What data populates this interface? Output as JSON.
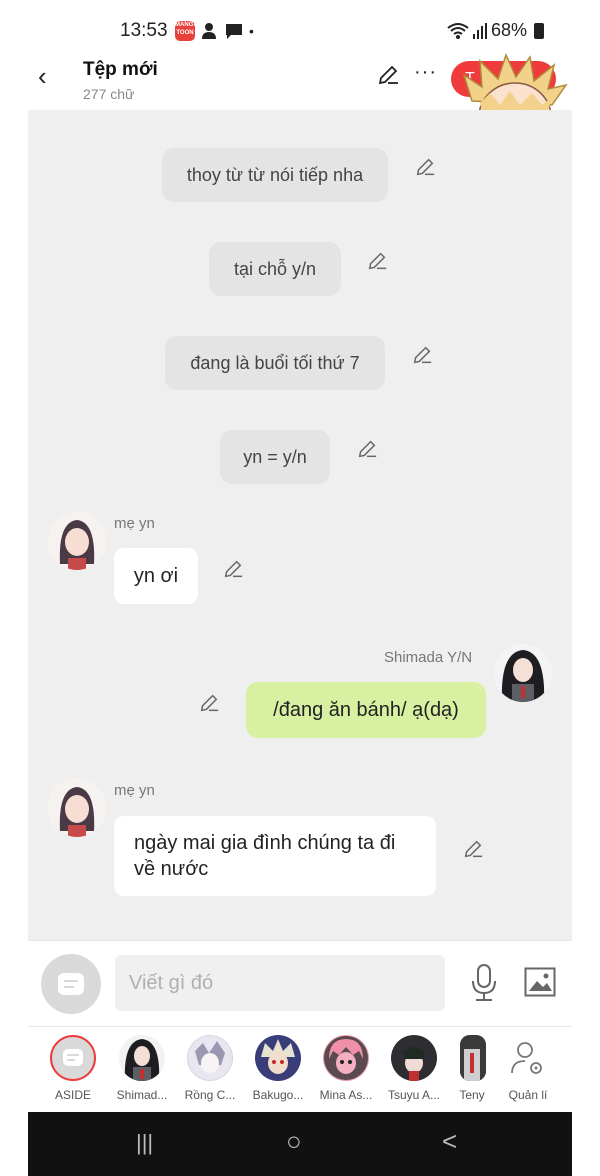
{
  "status_bar": {
    "time": "13:53",
    "battery": "68%",
    "app_badge": "MANGA TOON"
  },
  "header": {
    "title": "Tệp mới",
    "subtitle": "277 chữ",
    "more": "···",
    "red_button_label": "T"
  },
  "messages": {
    "narration": [
      "thoy từ từ nói tiếp nha",
      "tại chỗ y/n",
      "đang là buổi tối thứ 7",
      "yn = y/n"
    ],
    "mom_1": {
      "sender": "mẹ yn",
      "text": "yn ơi"
    },
    "shimada": {
      "sender": "Shimada Y/N",
      "text": "/đang ăn bánh/ ạ(dạ)"
    },
    "mom_2": {
      "sender": "mẹ yn",
      "line1": "ngày mai gia đình chúng ta đi",
      "line2": "về nước"
    }
  },
  "input": {
    "placeholder": "Viết gì đó"
  },
  "characters": [
    {
      "name": "ASIDE"
    },
    {
      "name": "Shimad..."
    },
    {
      "name": "Rồng C..."
    },
    {
      "name": "Bakugo..."
    },
    {
      "name": "Mina As..."
    },
    {
      "name": "Tsuyu A..."
    },
    {
      "name": "Teny"
    },
    {
      "name": "Quản lí"
    }
  ],
  "nav": {
    "recents": "|||",
    "home": "○",
    "back": "<"
  },
  "colors": {
    "accent_red": "#ef3b3b",
    "green_bubble": "#d7f0a2",
    "chat_bg": "#efefef"
  },
  "icons": [
    "back-arrow-icon",
    "pencil-icon",
    "more-icon",
    "mic-icon",
    "image-icon",
    "settings-user-icon"
  ]
}
